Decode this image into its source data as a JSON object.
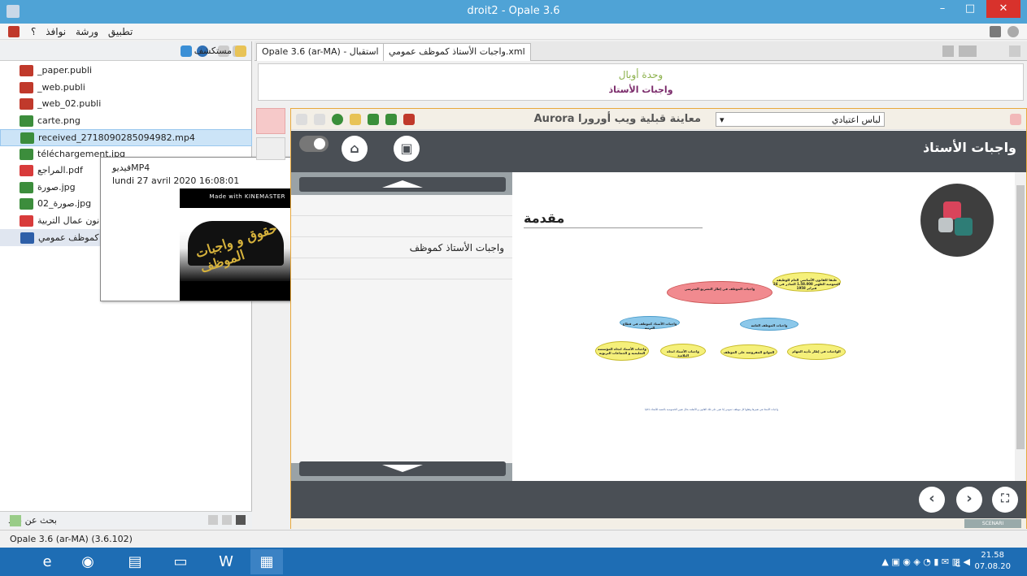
{
  "window": {
    "title": "droit2 - Opale 3.6",
    "minimize": "–",
    "maximize": "□",
    "close": "✕"
  },
  "menu": {
    "items": [
      "تطبيق",
      "ورشة",
      "نوافذ",
      "؟"
    ]
  },
  "explorer": {
    "title": "مستكشف",
    "files": [
      {
        "name": "_paper.publi",
        "color": "#c0392b"
      },
      {
        "name": "_web.publi",
        "color": "#c0392b"
      },
      {
        "name": "_web_02.publi",
        "color": "#c0392b"
      },
      {
        "name": "carte.png",
        "color": "#3c8d3c"
      },
      {
        "name": "received_2718090285094982.mp4",
        "color": "#3c8d3c"
      },
      {
        "name": "téléchargement.jpg",
        "color": "#3c8d3c"
      },
      {
        "name": "المراجع.pdf",
        "color": "#d83b3b"
      },
      {
        "name": "صورة.jpg",
        "color": "#3c8d3c"
      },
      {
        "name": "صورة_02.jpg",
        "color": "#3c8d3c"
      },
      {
        "name": "قانون عمال التربية",
        "color": "#d83b3b"
      },
      {
        "name": "واجبات الأستاذ كموظف عمومي",
        "color": "#2e5fa8"
      }
    ],
    "search": "بحث عن بنود"
  },
  "tooltip": {
    "type": "فيديوMP4",
    "date": "lundi 27 avril 2020 16:08:01",
    "thumb_brand": "Made with KINEMASTER",
    "thumb_caption": "حقوق و واجبات الموظف"
  },
  "statusbar": {
    "text": "Opale 3.6 (ar-MA) (3.6.102)"
  },
  "tabs": [
    {
      "label": "Opale 3.6 (ar-MA) - استقبال"
    },
    {
      "label": "واجبات الأستاذ كموظف عمومي.xml"
    }
  ],
  "unit": {
    "line1": "وحدة أوبال",
    "line2": "واجبات الأستاذ"
  },
  "preview": {
    "title": "Aurora معاينة قبلية ويب أورورا",
    "skin": "لباس اعتيادي",
    "header_title": "واجبات الأستاذ",
    "outline_item": "واجبات الأستاذ كموظف",
    "section_title": "مقدمة",
    "scenari": "SCENARI"
  },
  "mindmap": {
    "root": "واجبات الموظف في إطار التشريع المدرسي",
    "note": "طبقا للقانون الأساسي العام للوظيفة العمومية الظهير 1.58.008 الصادر في 24 فبراير 1958",
    "left": "واجبات الأستاذ كموظف في قطاع التربية",
    "right": "واجبات الموظف العامة",
    "leaves": [
      "واجبات الأستاذ اتجاه المؤسسة التعليمية و الجماعات التربوية",
      "واجبات الأستاذ اتجاه التلاميذ",
      "الموانع المفروضة على الموظف",
      "الواجبات في إطار تأدية المهام"
    ],
    "summary": "واجبات الأستاذ هي تعبيرها وفعلها كل موظف عمومي إذا تعين على تلك القانون و الأنظمة بحال تعيين الخصوصية بالنسبة للأستاذ داخليا"
  },
  "taskbar": {
    "time": "21.58",
    "date": "07.08.20",
    "lang": "ع"
  }
}
